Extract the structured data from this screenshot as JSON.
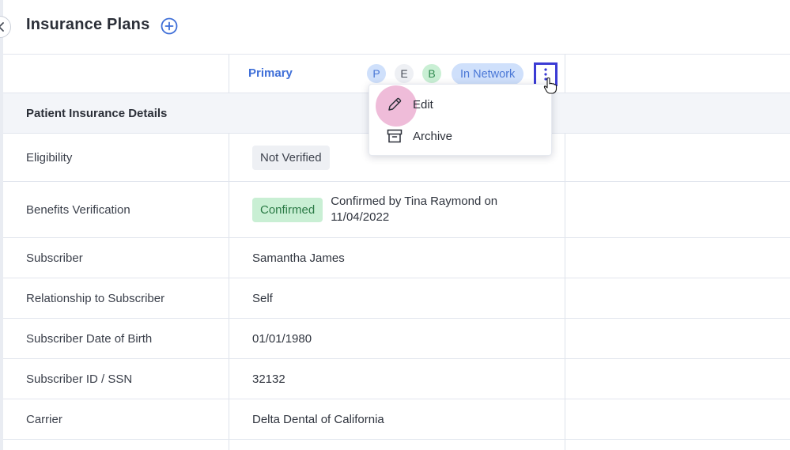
{
  "header": {
    "title": "Insurance Plans",
    "back_icon": "chevron-left-icon",
    "add_icon": "plus-circle-icon"
  },
  "plan": {
    "name": "Primary",
    "badges": [
      "P",
      "E",
      "B"
    ],
    "network_status": "In Network",
    "more_icon": "vertical-ellipsis-icon"
  },
  "menu": {
    "items": [
      {
        "label": "Edit",
        "icon": "pencil-icon"
      },
      {
        "label": "Archive",
        "icon": "archive-box-icon"
      }
    ]
  },
  "section_title": "Patient Insurance Details",
  "rows": [
    {
      "label": "Eligibility",
      "value": "Not Verified"
    },
    {
      "label": "Benefits Verification",
      "value": "Confirmed",
      "note": "Confirmed by Tina Raymond on 11/04/2022"
    },
    {
      "label": "Subscriber",
      "value": "Samantha James"
    },
    {
      "label": "Relationship to Subscriber",
      "value": "Self"
    },
    {
      "label": "Subscriber Date of Birth",
      "value": "01/01/1980"
    },
    {
      "label": "Subscriber ID / SSN",
      "value": "32132"
    },
    {
      "label": "Carrier",
      "value": "Delta Dental of California"
    }
  ],
  "colors": {
    "accent": "#3f6fd8",
    "focus_outline": "#3b3bd4",
    "confirmed_bg": "#c9efd4",
    "click_halo": "#e9a6cc"
  }
}
